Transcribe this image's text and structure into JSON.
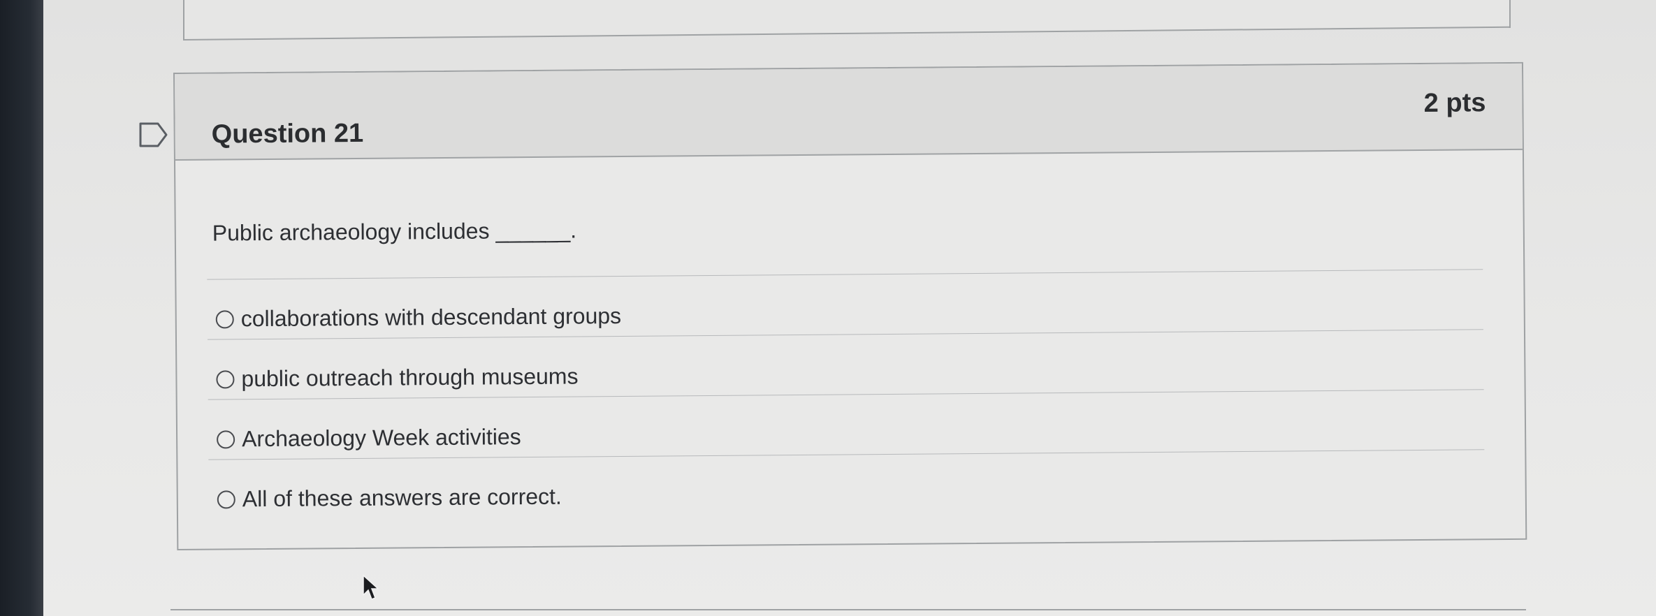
{
  "question": {
    "title": "Question 21",
    "points": "2 pts",
    "text": "Public archaeology includes ______.",
    "answers": [
      "collaborations with descendant groups",
      "public outreach through museums",
      "Archaeology Week activities",
      "All of these answers are correct."
    ]
  },
  "icons": {
    "flag": "flag-icon",
    "radio": "radio-button-icon",
    "cursor": "mouse-pointer-icon"
  },
  "colors": {
    "text": "#2d2f33",
    "border": "#9ea1a3",
    "header_background": "#dcdcdb",
    "page_background": "#e9e9e8"
  }
}
